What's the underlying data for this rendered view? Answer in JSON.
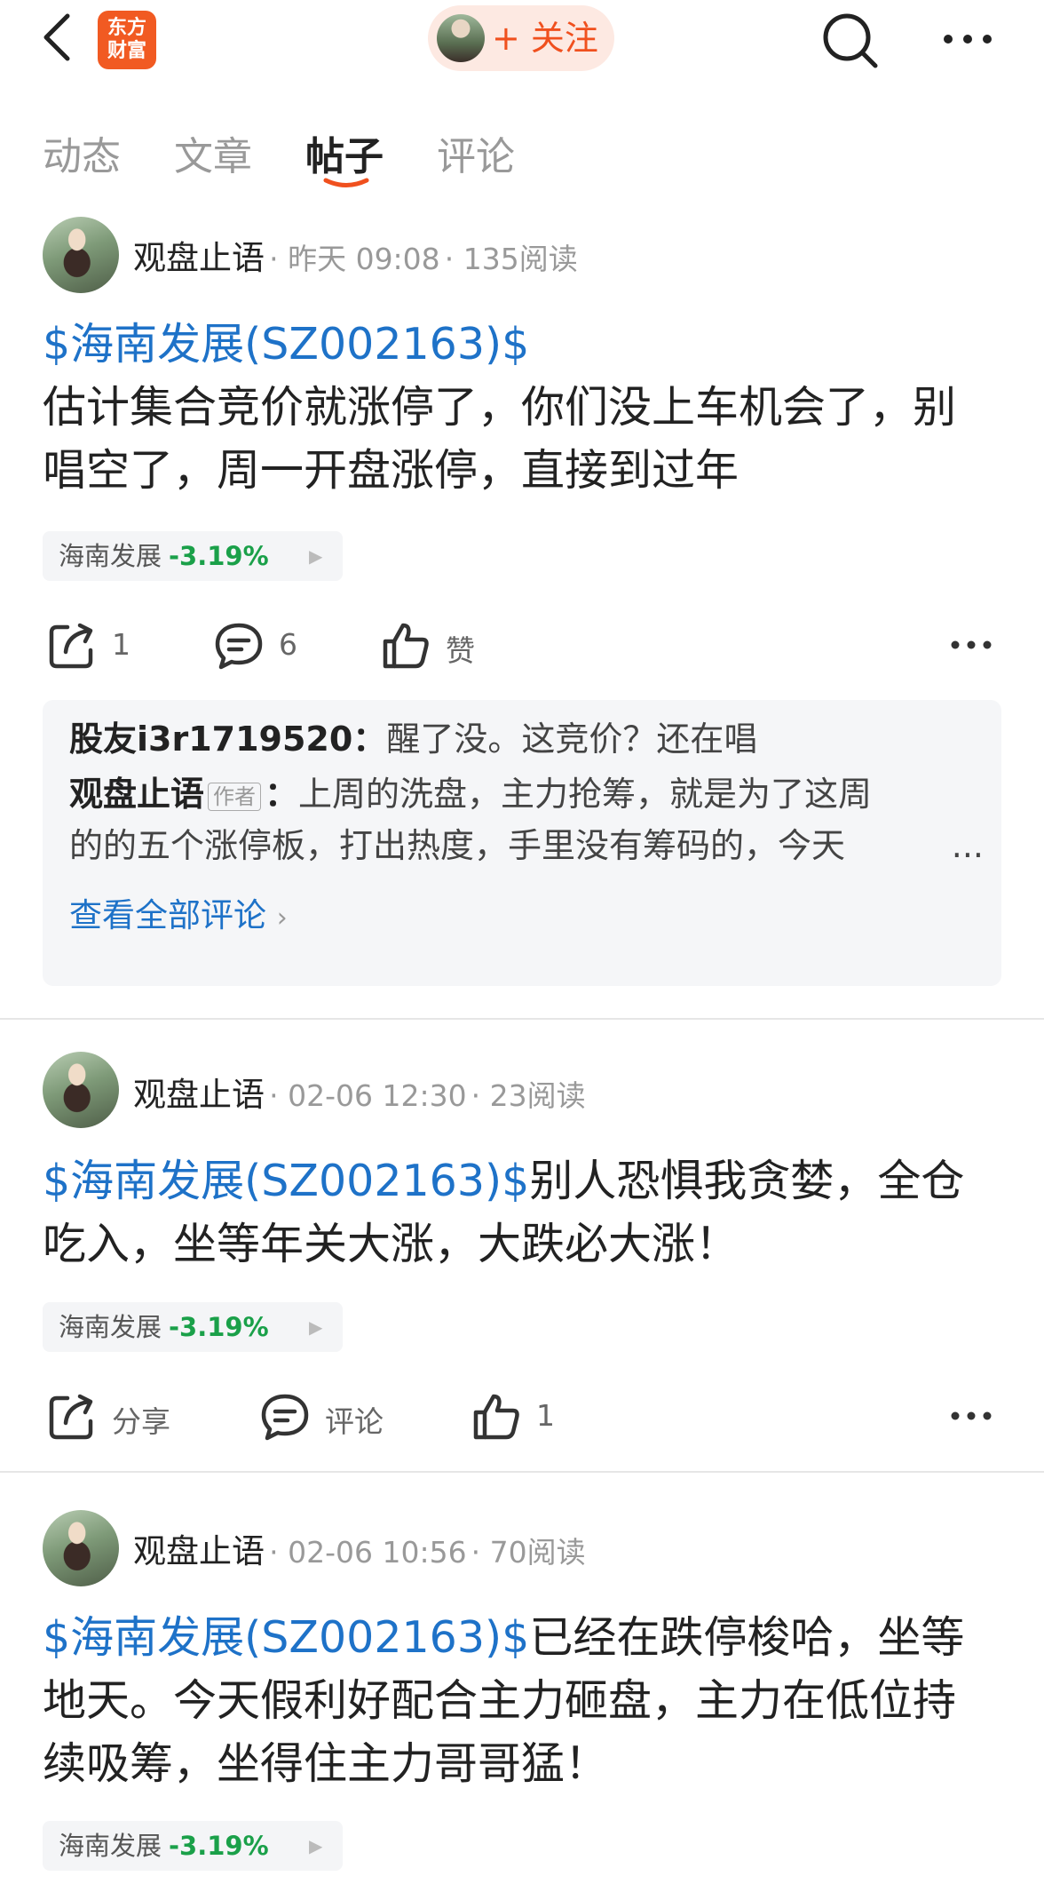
{
  "header": {
    "logo_text_line1": "东方",
    "logo_text_line2": "财富",
    "follow_label": "+ 关注"
  },
  "tabs": [
    {
      "label": "动态",
      "active": false
    },
    {
      "label": "文章",
      "active": false
    },
    {
      "label": "帖子",
      "active": true
    },
    {
      "label": "评论",
      "active": false
    }
  ],
  "colors": {
    "accent_orange": "#f0501e",
    "link_blue": "#1e72c8",
    "stock_down_green": "#1aa049"
  },
  "posts": [
    {
      "author": "观盘止语",
      "time": "昨天 09:08",
      "reads": "135阅读",
      "stock_link": "$海南发展(SZ002163)$",
      "text_line1": "估计集合竞价就涨停了，你们没上车机会了，别",
      "text_line2": "唱空了，周一开盘涨停，直接到过年",
      "chip": {
        "name": "海南发展",
        "pct": "-3.19%"
      },
      "actions": {
        "share": "1",
        "comment": "6",
        "like": "赞"
      },
      "comments": {
        "c1_user": "股友i3r1719520",
        "c1_sep": "：",
        "c1_text": "醒了没。这竞价？还在唱",
        "c2_user": "观盘止语",
        "c2_tag": "作者",
        "c2_sep": "：",
        "c2_text1": "上周的洗盘，主力抢筹，就是为了这周",
        "c2_text2": "的的五个涨停板，打出热度，手里没有筹码的，今天",
        "c2_ellipsis": "...",
        "view_all": "查看全部评论"
      }
    },
    {
      "author": "观盘止语",
      "time": "02-06 12:30",
      "reads": "23阅读",
      "stock_link": "$海南发展(SZ002163)$",
      "text_line1_rest": "别人恐惧我贪婪，全仓",
      "text_line2": "吃入，坐等年关大涨，大跌必大涨！",
      "chip": {
        "name": "海南发展",
        "pct": "-3.19%"
      },
      "actions": {
        "share": "分享",
        "comment": "评论",
        "like": "1"
      }
    },
    {
      "author": "观盘止语",
      "time": "02-06 10:56",
      "reads": "70阅读",
      "stock_link": "$海南发展(SZ002163)$",
      "text_line1_rest": "已经在跌停梭哈，坐等",
      "text_line2": "地天。今天假利好配合主力砸盘，主力在低位持",
      "text_line3": "续吸筹，坐得住主力哥哥猛！",
      "chip": {
        "name": "海南发展",
        "pct": "-3.19%"
      }
    }
  ]
}
